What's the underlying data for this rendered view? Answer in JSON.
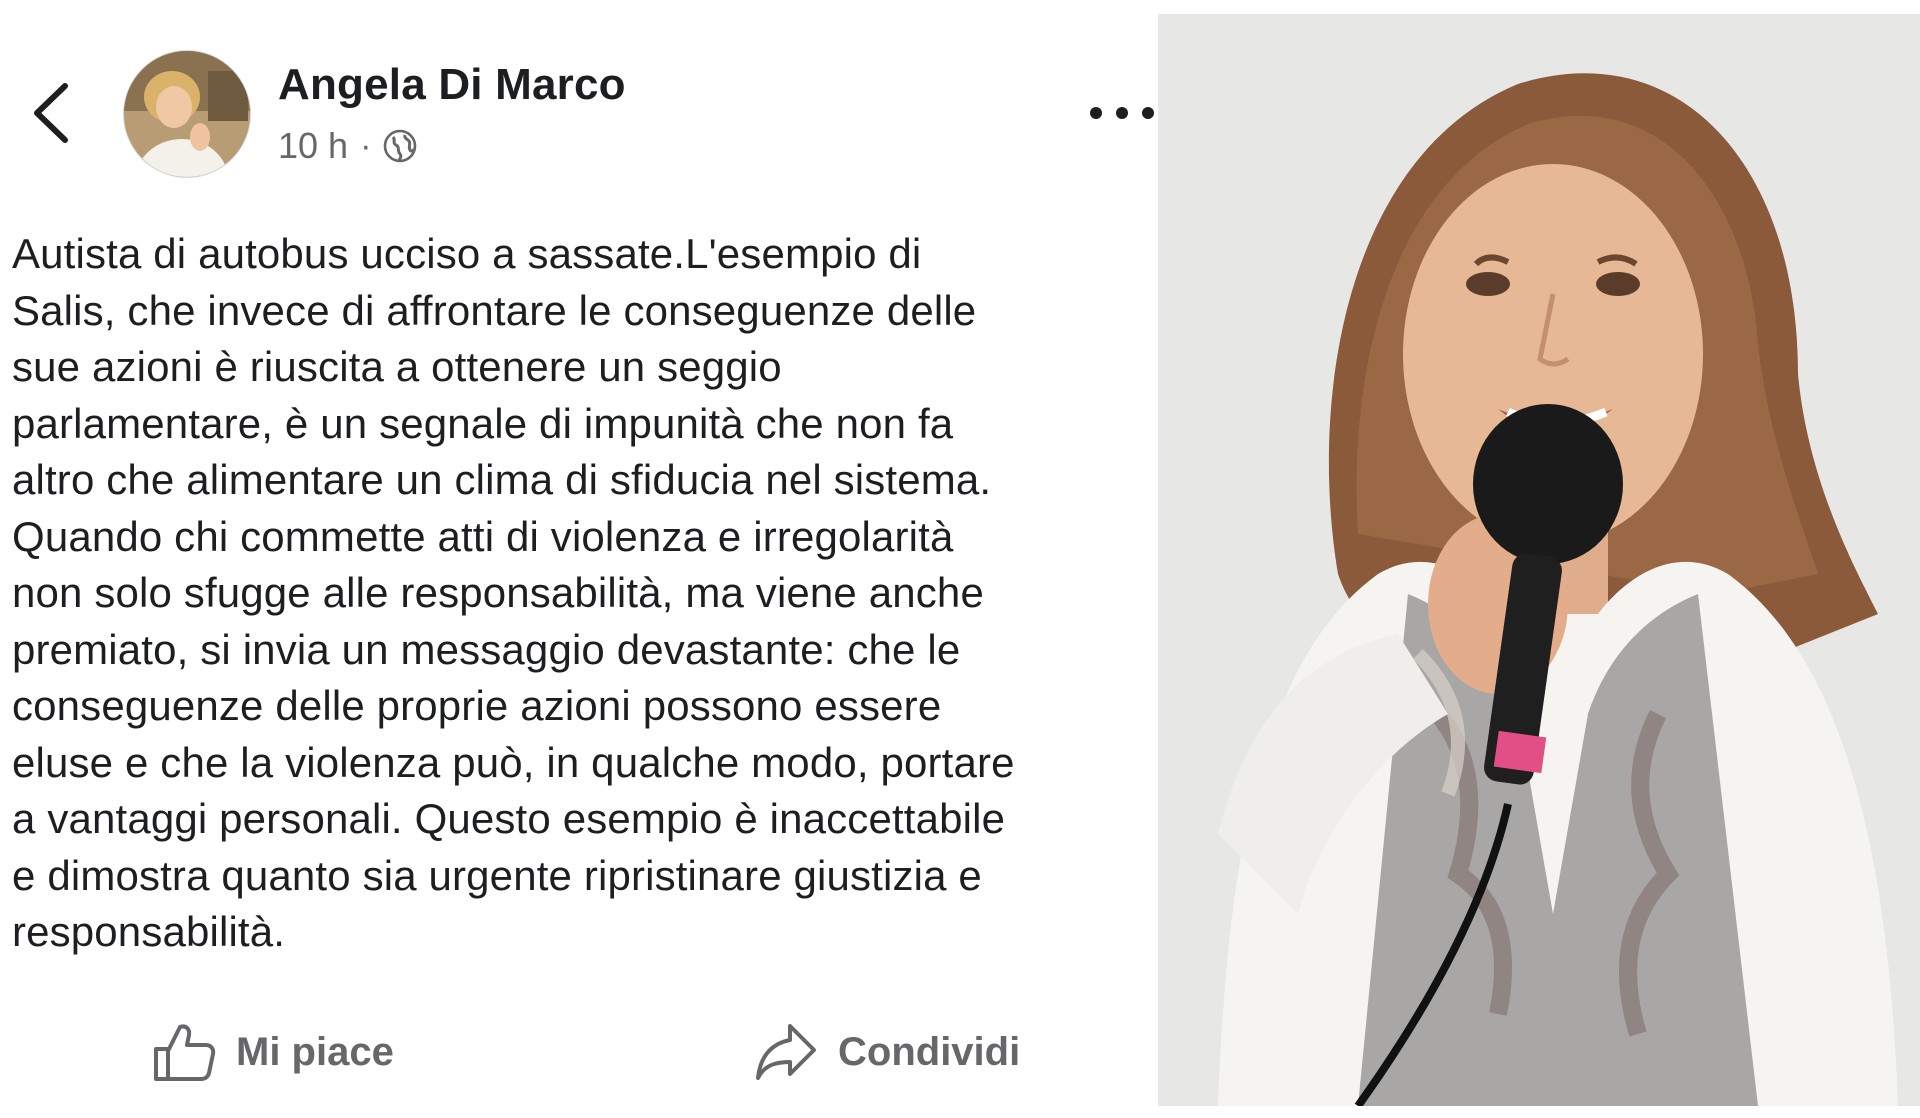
{
  "post": {
    "author": "Angela Di Marco",
    "time": "10 h",
    "separator": "·",
    "visibility_icon": "globe-icon",
    "text": "Autista di autobus ucciso a sassate.L'esempio di\nSalis, che invece di affrontare le conseguenze delle\nsue azioni è riuscita a ottenere un seggio\nparlamentare, è un segnale di impunità che non fa\naltro che alimentare un clima di sfiducia nel sistema.\nQuando chi commette atti di violenza e irregolarità\nnon solo sfugge alle responsabilità, ma viene anche\npremiato, si invia un messaggio devastante: che le\nconseguenze delle proprie azioni possono essere\neluse e che la violenza può, in qualche modo, portare\na vantaggi personali. Questo esempio è inaccettabile\ne dimostra quanto sia urgente ripristinare giustizia e\nresponsabilità.",
    "actions": {
      "like_label": "Mi piace",
      "share_label": "Condividi"
    }
  },
  "icons": {
    "back": "chevron-left-icon",
    "more": "more-options-icon",
    "like": "thumbs-up-icon",
    "share": "share-icon"
  },
  "colors": {
    "text": "#1c1e21",
    "secondary": "#65676b",
    "background": "#ffffff"
  }
}
